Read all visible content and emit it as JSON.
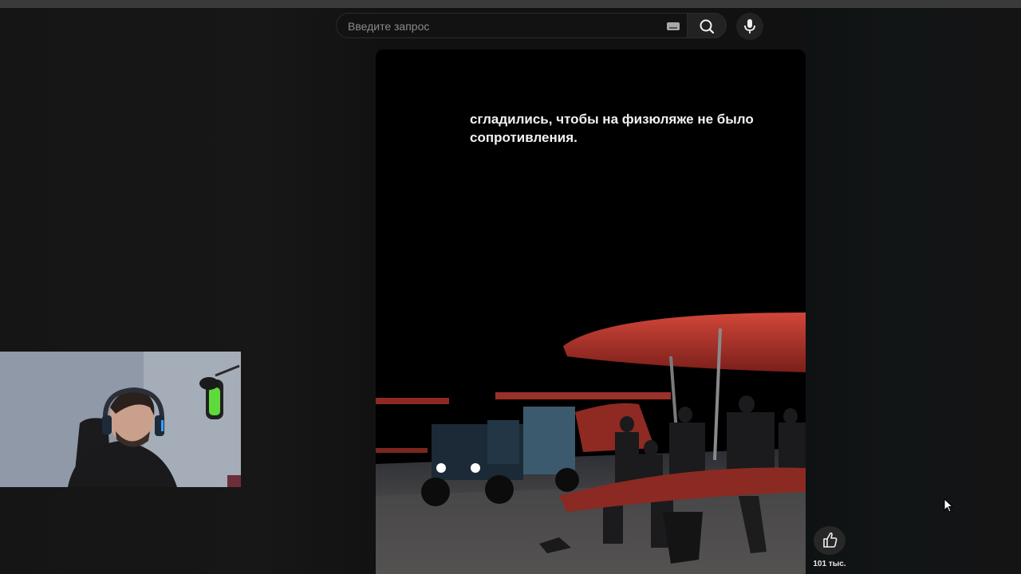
{
  "search": {
    "placeholder": "Введите запрос",
    "search_icon": "search-icon",
    "keyboard_icon": "keyboard-icon",
    "mic_icon": "microphone-icon"
  },
  "video": {
    "subtitle": "сгладились, чтобы на физюляже не было сопротивления."
  },
  "actions": {
    "like_icon": "thumbs-up-icon",
    "like_count": "101 тыс."
  },
  "colors": {
    "background": "#0f0f0f",
    "search_border": "#2b2b2b",
    "button_bg": "#222222",
    "plane_red": "#b7342a"
  }
}
